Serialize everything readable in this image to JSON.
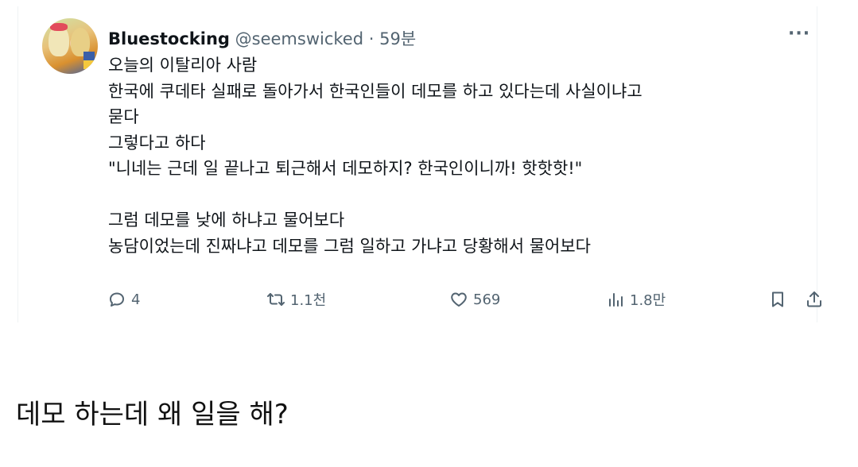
{
  "tweet": {
    "display_name": "Bluestocking",
    "handle": "@seemswicked",
    "separator": "·",
    "time": "59분",
    "more_label": "···",
    "lines": [
      "오늘의 이탈리아 사람",
      "한국에 쿠데타 실패로 돌아가서 한국인들이 데모를 하고 있다는데 사실이냐고",
      "묻다",
      "그렇다고 하다",
      "\"니네는 근데 일 끝나고 퇴근해서 데모하지? 한국인이니까! 핫핫핫!\"",
      "",
      "그럼 데모를 낮에 하냐고 물어보다",
      "농담이었는데 진짜냐고 데모를 그럼 일하고 가냐고 당황해서 물어보다"
    ],
    "actions": {
      "replies": "4",
      "retweets": "1.1천",
      "likes": "569",
      "views": "1.8만"
    },
    "icons": {
      "reply": "reply-icon",
      "retweet": "retweet-icon",
      "like": "heart-icon",
      "views": "views-chart-icon",
      "bookmark": "bookmark-icon",
      "share": "share-icon"
    }
  },
  "caption": "데모 하는데 왜 일을 해?"
}
